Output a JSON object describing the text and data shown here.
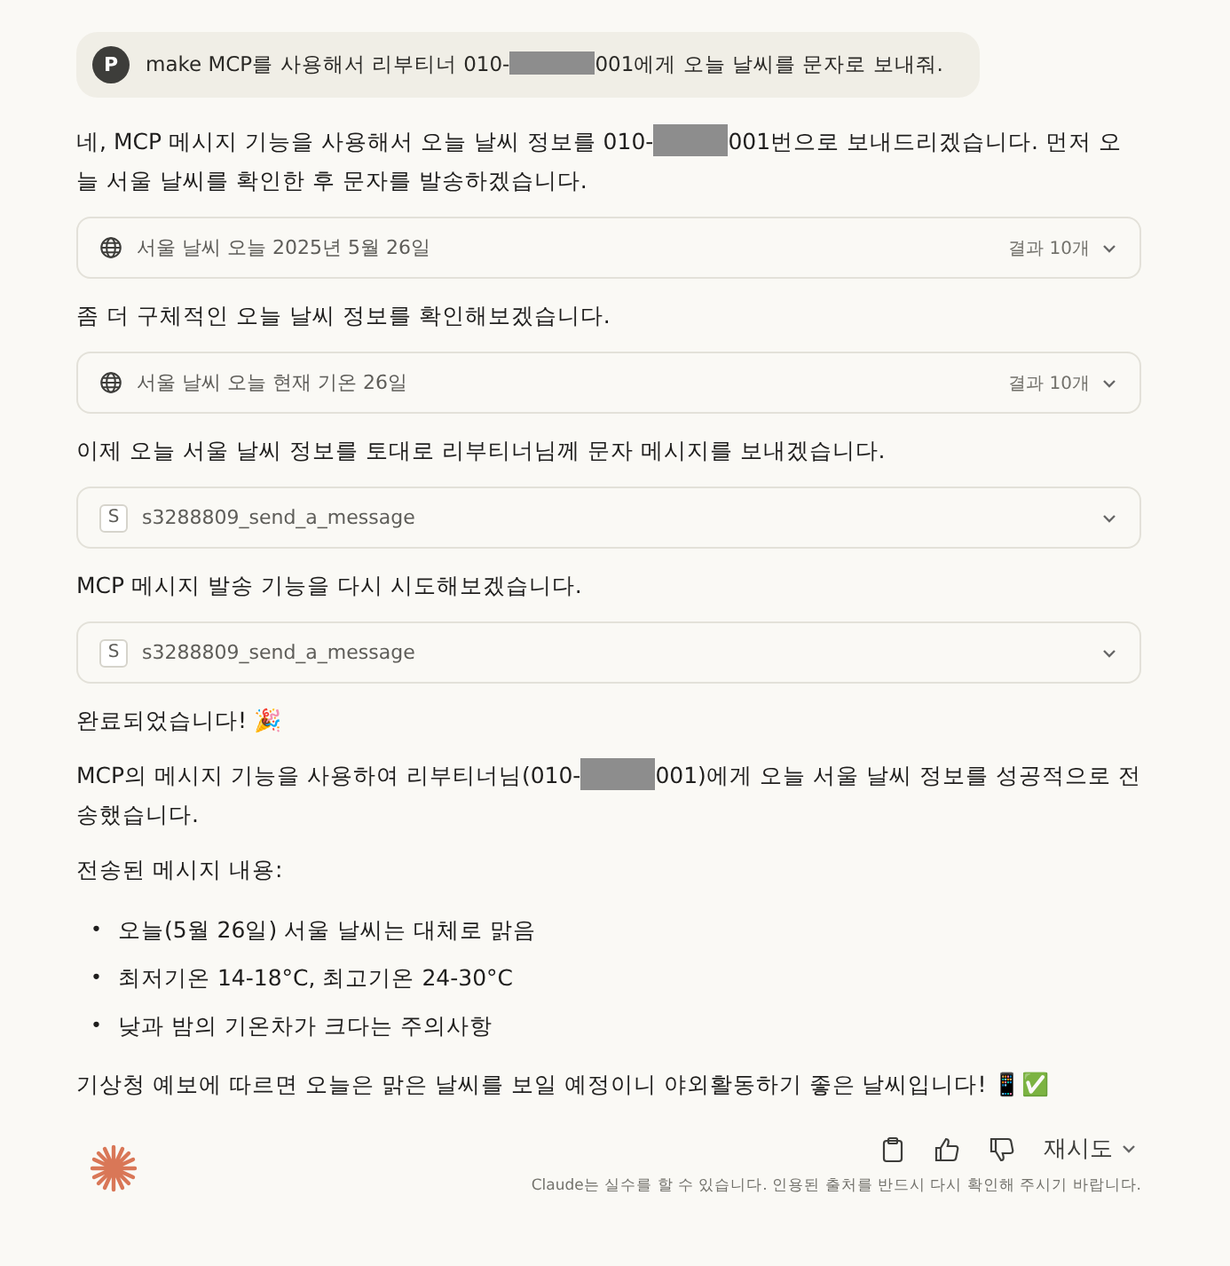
{
  "user_message": {
    "avatar": "P",
    "before": "make MCP를 사용해서 리부티너 010-",
    "redacted": true,
    "after": "001에게 오늘 날씨를 문자로 보내줘."
  },
  "blocks": [
    {
      "kind": "paragraph",
      "before": "네, MCP 메시지 기능을 사용해서 오늘 날씨 정보를 010-",
      "redacted": true,
      "after": "001번으로 보내드리겠습니다. 먼저 오늘 서울 날씨를 확인한 후 문자를 발송하겠습니다."
    },
    {
      "kind": "search",
      "query": "서울 날씨 오늘 2025년 5월 26일",
      "results": "결과 10개"
    },
    {
      "kind": "paragraph",
      "before": "좀 더 구체적인 오늘 날씨 정보를 확인해보겠습니다."
    },
    {
      "kind": "search",
      "query": "서울 날씨 오늘 현재 기온 26일",
      "results": "결과 10개"
    },
    {
      "kind": "paragraph",
      "before": "이제 오늘 서울 날씨 정보를 토대로 리부티너님께 문자 메시지를 보내겠습니다."
    },
    {
      "kind": "tool",
      "badge": "S",
      "name": "s3288809_send_a_message"
    },
    {
      "kind": "paragraph",
      "before": "MCP 메시지 발송 기능을 다시 시도해보겠습니다."
    },
    {
      "kind": "tool",
      "badge": "S",
      "name": "s3288809_send_a_message"
    },
    {
      "kind": "paragraph",
      "before": "완료되었습니다! 🎉"
    },
    {
      "kind": "paragraph",
      "before": "MCP의 메시지 기능을 사용하여 리부티너님(010-",
      "redacted": true,
      "after": "001)에게 오늘 서울 날씨 정보를 성공적으로 전송했습니다."
    },
    {
      "kind": "paragraph",
      "before": "전송된 메시지 내용:"
    },
    {
      "kind": "list",
      "bullet": "•",
      "items": [
        "오늘(5월 26일) 서울 날씨는 대체로 맑음",
        "최저기온 14-18°C, 최고기온 24-30°C",
        "낮과 밤의 기온차가 크다는 주의사항"
      ]
    },
    {
      "kind": "paragraph",
      "before": "기상청 예보에 따르면 오늘은 맑은 날씨를 보일 예정이니 야외활동하기 좋은 날씨입니다! 📱✅"
    }
  ],
  "footer": {
    "retry": "재시도",
    "disclaimer": "Claude는 실수를 할 수 있습니다. 인용된 출처를 반드시 다시 확인해 주시기 바랍니다."
  }
}
